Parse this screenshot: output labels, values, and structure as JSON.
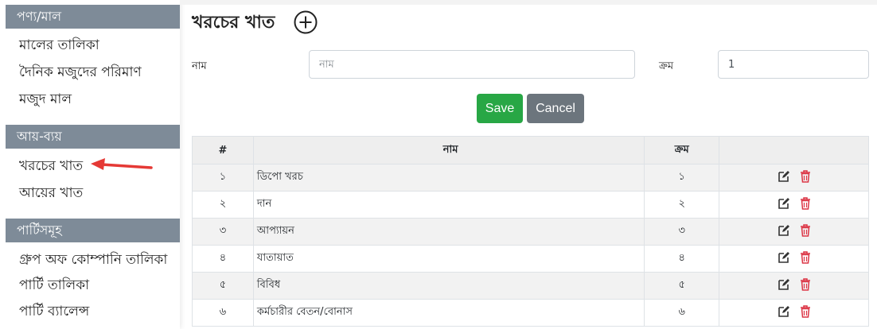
{
  "sidebar": {
    "sections": [
      {
        "title": "পণ্য/মাল",
        "items": [
          "মালের তালিকা",
          "দৈনিক মজুদের পরিমাণ",
          "মজুদ মাল"
        ]
      },
      {
        "title": "আয়-ব্যয়",
        "items": [
          "খরচের খাত",
          "আয়ের খাত"
        ]
      },
      {
        "title": "পার্টিসমূহ",
        "items": [
          "গ্রুপ অফ কোম্পানি তালিকা",
          "পার্টি তালিকা",
          "পার্টি ব্যালেন্স"
        ]
      }
    ],
    "active_item": "খরচের খাত"
  },
  "page": {
    "title": "খরচের খাত",
    "add_icon": "plus-circle-icon"
  },
  "form": {
    "name_label": "নাম",
    "name_placeholder": "নাম",
    "name_value": "",
    "order_label": "ক্রম",
    "order_value": "1",
    "save_label": "Save",
    "cancel_label": "Cancel"
  },
  "table": {
    "headers": [
      "#",
      "নাম",
      "ক্রম",
      ""
    ],
    "rows": [
      {
        "num": "১",
        "name": "ডিপো খরচ",
        "order": "১"
      },
      {
        "num": "২",
        "name": "দান",
        "order": "২"
      },
      {
        "num": "৩",
        "name": "আপ্যায়ন",
        "order": "৩"
      },
      {
        "num": "৪",
        "name": "যাতায়াত",
        "order": "৪"
      },
      {
        "num": "৫",
        "name": "বিবিধ",
        "order": "৫"
      },
      {
        "num": "৬",
        "name": "কর্মচারীর বেতন/বোনাস",
        "order": "৬"
      }
    ],
    "row_actions": [
      "edit-icon",
      "delete-icon"
    ]
  },
  "colors": {
    "section_header": "#7e8b98",
    "save": "#28a745",
    "cancel": "#6c757d",
    "delete": "#dc3545",
    "arrow": "#e53935"
  }
}
